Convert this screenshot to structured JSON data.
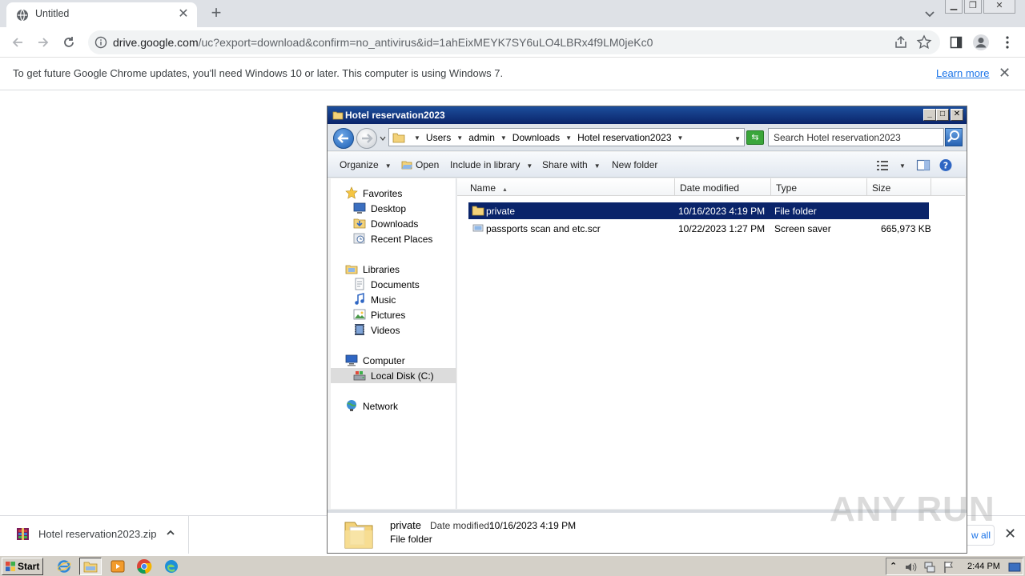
{
  "browser": {
    "tab_title": "Untitled",
    "url_domain": "drive.google.com",
    "url_path": "/uc?export=download&confirm=no_antivirus&id=1ahEixMEYK7SY6uLO4LBRx4f9LM0jeKc0",
    "infobar_message": "To get future Google Chrome updates, you'll need Windows 10 or later. This computer is using Windows 7.",
    "infobar_link": "Learn more",
    "close_glyph": "✕",
    "new_tab_glyph": "+"
  },
  "download_shelf": {
    "file_name": "Hotel reservation2023.zip",
    "show_all_label": "w all"
  },
  "explorer": {
    "title": "Hotel reservation2023",
    "breadcrumbs": [
      "Users",
      "admin",
      "Downloads",
      "Hotel reservation2023"
    ],
    "search_placeholder": "Search Hotel reservation2023",
    "commands": {
      "organize": "Organize",
      "open": "Open",
      "include_in_library": "Include in library",
      "share_with": "Share with",
      "new_folder": "New folder"
    },
    "nav": {
      "favorites": "Favorites",
      "desktop": "Desktop",
      "downloads": "Downloads",
      "recent_places": "Recent Places",
      "libraries": "Libraries",
      "documents": "Documents",
      "music": "Music",
      "pictures": "Pictures",
      "videos": "Videos",
      "computer": "Computer",
      "local_disk": "Local Disk (C:)",
      "network": "Network"
    },
    "columns": {
      "name": "Name",
      "date_modified": "Date modified",
      "type": "Type",
      "size": "Size"
    },
    "files": [
      {
        "name": "private",
        "date": "10/16/2023 4:19 PM",
        "type": "File folder",
        "size": "",
        "selected": true
      },
      {
        "name": "passports scan and etc.scr",
        "date": "10/22/2023 1:27 PM",
        "type": "Screen saver",
        "size": "665,973 KB",
        "selected": false
      }
    ],
    "details": {
      "name": "private",
      "date_label": "Date modified:",
      "date_value": "10/16/2023 4:19 PM",
      "type": "File folder"
    }
  },
  "taskbar": {
    "start_label": "Start",
    "clock": "2:44 PM"
  },
  "watermark": "ANY RUN",
  "colors": {
    "selection": "#0a246a",
    "chrome_tabstrip": "#dee1e6",
    "link": "#1a73e8"
  }
}
